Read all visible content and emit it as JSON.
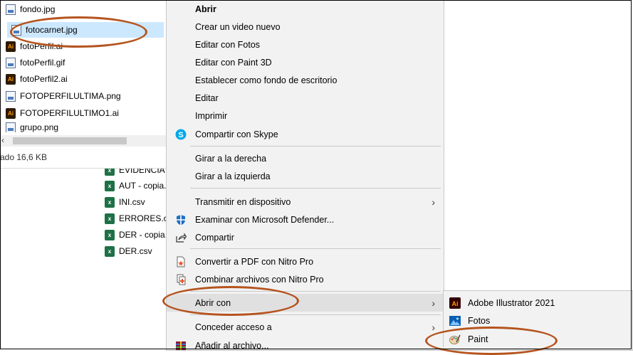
{
  "explorer": {
    "files": [
      {
        "name": "fondo.jpg",
        "type": "image"
      },
      {
        "name": "fotocarnet.jpg",
        "type": "image"
      },
      {
        "name": "fotoPerfil.ai",
        "type": "ai"
      },
      {
        "name": "fotoPerfil.gif",
        "type": "image"
      },
      {
        "name": "fotoPerfil2.ai",
        "type": "ai"
      },
      {
        "name": "FOTOPERFILULTIMA.png",
        "type": "image"
      },
      {
        "name": "FOTOPERFILULTIMO1.ai",
        "type": "ai"
      },
      {
        "name": "grupo.png",
        "type": "image"
      }
    ],
    "status": "ado  16,6 KB",
    "ai_badge": "Ai"
  },
  "background_files": [
    {
      "name": "EVIDENCIA"
    },
    {
      "name": "AUT - copia.csv"
    },
    {
      "name": "INI.csv"
    },
    {
      "name": "ERRORES.csv"
    },
    {
      "name": "DER - copia.csv"
    },
    {
      "name": "DER.csv"
    }
  ],
  "context_menu": {
    "items": [
      {
        "label": "Abrir"
      },
      {
        "label": "Crear un video nuevo"
      },
      {
        "label": "Editar con Fotos"
      },
      {
        "label": "Editar con Paint 3D"
      },
      {
        "label": "Establecer como fondo de escritorio"
      },
      {
        "label": "Editar"
      },
      {
        "label": "Imprimir"
      },
      {
        "label": "Compartir con Skype"
      },
      {
        "label": "Girar a la derecha"
      },
      {
        "label": "Girar a la izquierda"
      },
      {
        "label": "Transmitir en dispositivo"
      },
      {
        "label": "Examinar con Microsoft Defender..."
      },
      {
        "label": "Compartir"
      },
      {
        "label": "Convertir a PDF con Nitro Pro"
      },
      {
        "label": "Combinar archivos con Nitro Pro"
      },
      {
        "label": "Abrir con"
      },
      {
        "label": "Conceder acceso a"
      },
      {
        "label": "Añadir al archivo..."
      }
    ],
    "chevron": "›"
  },
  "submenu": {
    "items": [
      {
        "label": "Adobe Illustrator 2021"
      },
      {
        "label": "Fotos"
      },
      {
        "label": "Paint"
      }
    ]
  },
  "colors": {
    "annotation_oval": "#b5541f",
    "selection": "#cce8ff",
    "menu_bg": "#f2f2f2"
  }
}
